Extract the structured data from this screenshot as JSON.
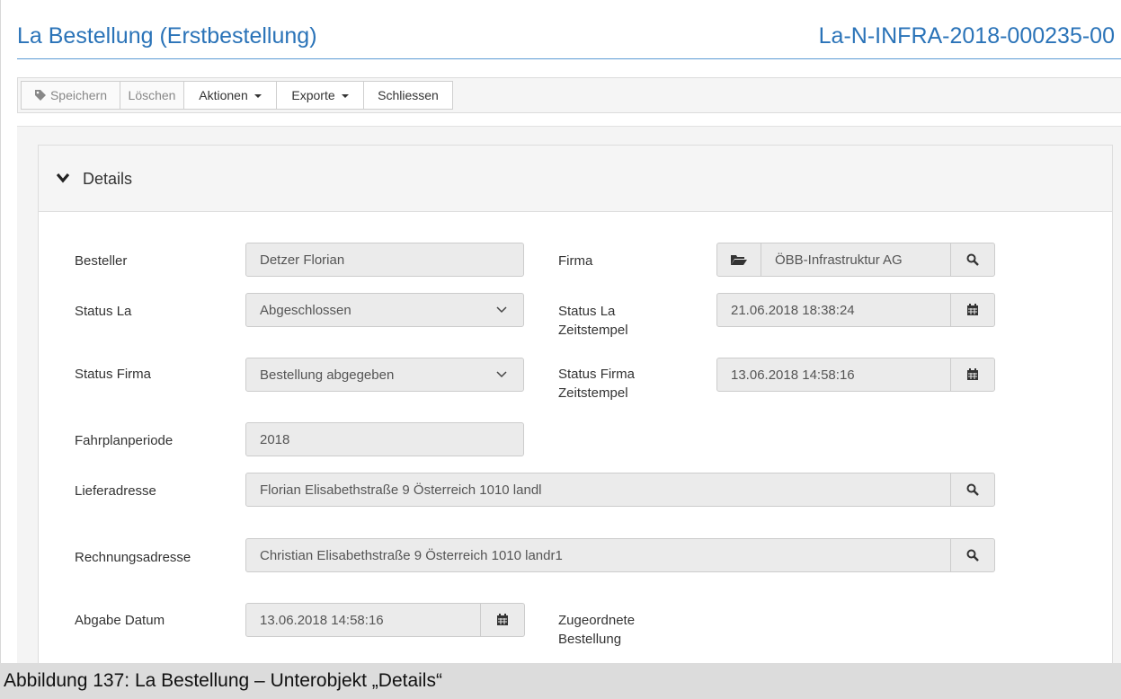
{
  "header": {
    "title": "La Bestellung (Erstbestellung)",
    "doc_id": "La-N-INFRA-2018-000235-00"
  },
  "toolbar": {
    "save": "Speichern",
    "delete": "Löschen",
    "actions": "Aktionen",
    "exports": "Exporte",
    "close": "Schliessen"
  },
  "panel": {
    "title": "Details"
  },
  "form": {
    "besteller": {
      "label": "Besteller",
      "value": "Detzer Florian"
    },
    "firma": {
      "label": "Firma",
      "value": "ÖBB-Infrastruktur AG"
    },
    "status_la": {
      "label": "Status La",
      "value": "Abgeschlossen"
    },
    "status_la_ts": {
      "label_line1": "Status La",
      "label_line2": "Zeitstempel",
      "value": "21.06.2018 18:38:24"
    },
    "status_firma": {
      "label": "Status Firma",
      "value": "Bestellung abgegeben"
    },
    "status_firma_ts": {
      "label_line1": "Status Firma",
      "label_line2": "Zeitstempel",
      "value": "13.06.2018 14:58:16"
    },
    "fahrplanperiode": {
      "label": "Fahrplanperiode",
      "value": "2018"
    },
    "lieferadresse": {
      "label": "Lieferadresse",
      "value": "Florian Elisabethstraße 9 Österreich 1010 landl"
    },
    "rechnungsadresse": {
      "label": "Rechnungsadresse",
      "value": "Christian Elisabethstraße 9 Österreich 1010 landr1"
    },
    "abgabe_datum": {
      "label": "Abgabe Datum",
      "value": "13.06.2018 14:58:16"
    },
    "zugeordnete": {
      "label_line1": "Zugeordnete",
      "label_line2": "Bestellung"
    }
  },
  "caption": "Abbildung 137: La Bestellung – Unterobjekt „Details“",
  "colors": {
    "title_blue": "#2a73b8",
    "field_bg": "#ebebeb",
    "caption_bg": "#dcdcdc"
  },
  "icons": [
    "tag-icon",
    "caret-down-icon",
    "chevron-down-icon",
    "folder-open-icon",
    "search-icon",
    "calendar-icon"
  ]
}
